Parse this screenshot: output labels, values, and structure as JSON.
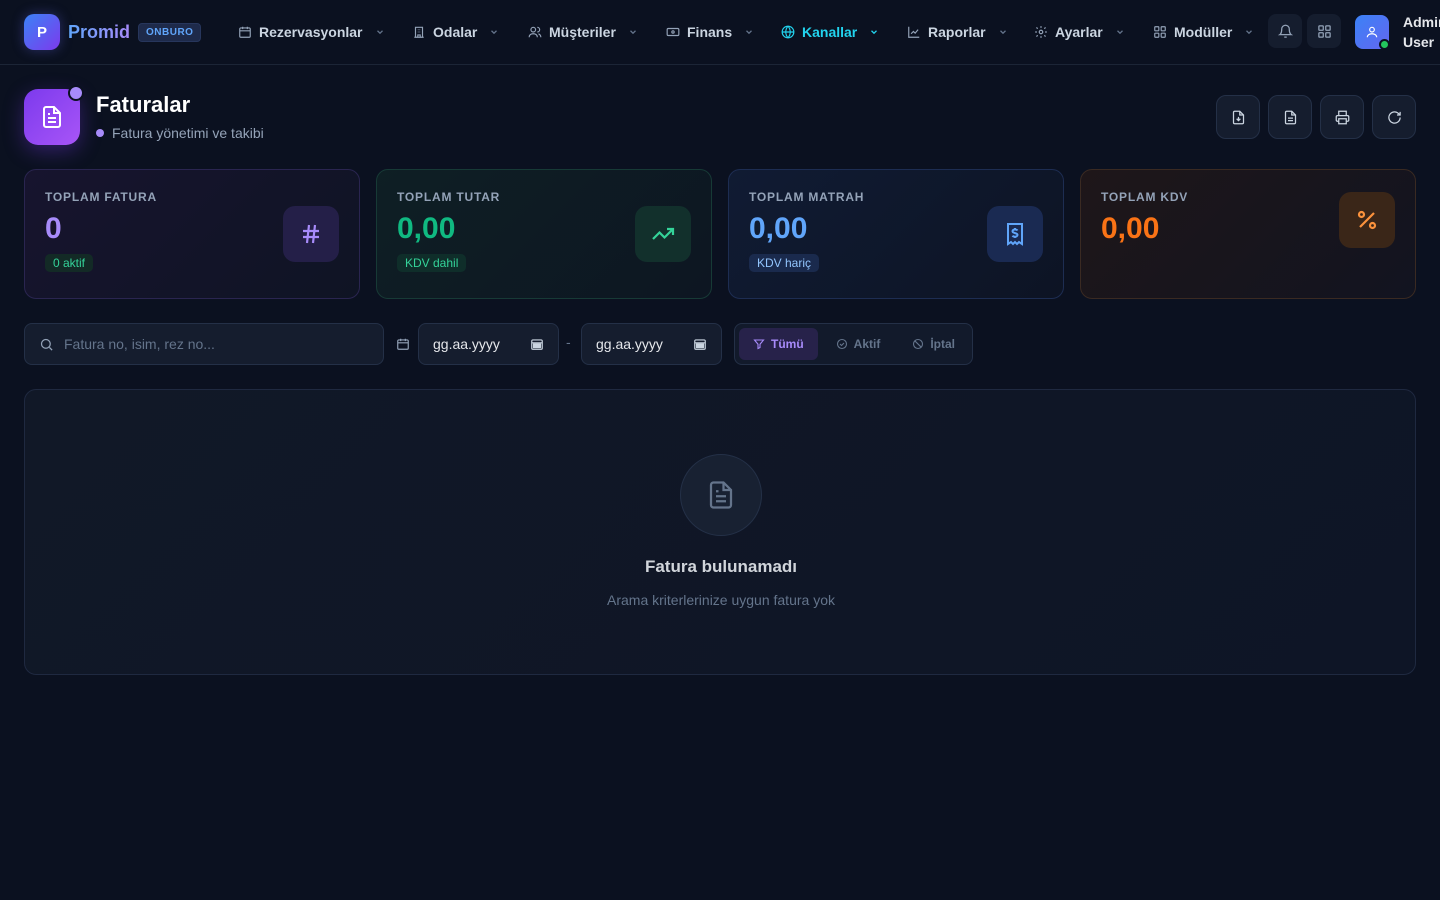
{
  "brand": {
    "logo_letter": "P",
    "name": "Promid",
    "badge": "ONBURO"
  },
  "nav": [
    {
      "label": "Rezervasyonlar",
      "icon": "calendar-icon"
    },
    {
      "label": "Odalar",
      "icon": "building-icon"
    },
    {
      "label": "Müşteriler",
      "icon": "users-icon"
    },
    {
      "label": "Finans",
      "icon": "banknote-icon"
    },
    {
      "label": "Kanallar",
      "icon": "globe-icon",
      "active": true
    },
    {
      "label": "Raporlar",
      "icon": "chart-icon"
    },
    {
      "label": "Ayarlar",
      "icon": "gear-icon"
    },
    {
      "label": "Modüller",
      "icon": "grid-icon"
    }
  ],
  "user": {
    "name": "Admin User"
  },
  "page": {
    "title": "Faturalar",
    "subtitle": "Fatura yönetimi ve takibi"
  },
  "actions": [
    "file-download-icon",
    "file-text-icon",
    "printer-icon",
    "refresh-icon"
  ],
  "stats": {
    "total_invoices": {
      "label": "TOPLAM FATURA",
      "value": "0",
      "badge": "0 aktif"
    },
    "total_amount": {
      "label": "TOPLAM TUTAR",
      "value": "0,00",
      "badge": "KDV dahil"
    },
    "total_base": {
      "label": "TOPLAM MATRAH",
      "value": "0,00",
      "badge": "KDV hariç"
    },
    "total_vat": {
      "label": "TOPLAM KDV",
      "value": "0,00"
    }
  },
  "filters": {
    "search_placeholder": "Fatura no, isim, rez no...",
    "date_from": "gg.aa.yyyy",
    "date_sep": "-",
    "date_to": "gg.aa.yyyy",
    "status": {
      "all": "Tümü",
      "active": "Aktif",
      "cancelled": "İptal",
      "selected": "all"
    }
  },
  "empty": {
    "title": "Fatura bulunamadı",
    "subtitle": "Arama kriterlerinize uygun fatura yok"
  },
  "colors": {
    "background": "#0b1120",
    "accent_cyan": "#22d3ee",
    "purple": "#a78bfa",
    "green": "#10b981",
    "blue": "#60a5fa",
    "orange": "#f97316"
  }
}
